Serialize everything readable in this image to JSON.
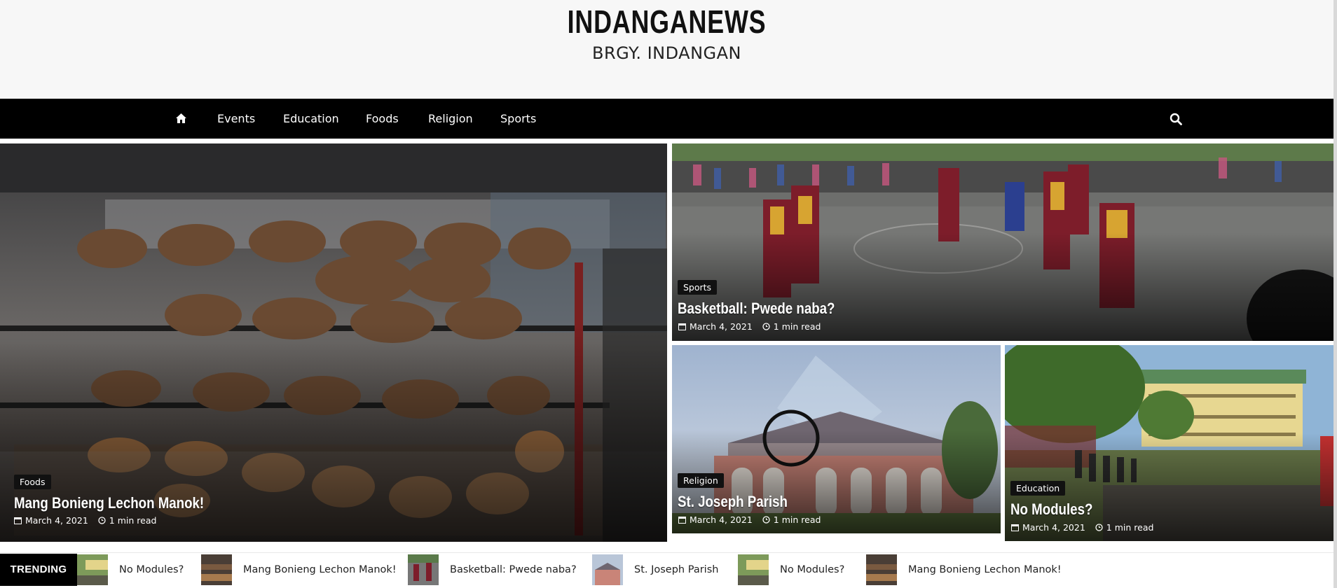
{
  "header": {
    "site_title": "INDANGANEWS",
    "tagline": "BRGY. INDANGAN"
  },
  "nav": {
    "home_icon": "home-icon",
    "items": [
      "Events",
      "Education",
      "Foods",
      "Religion",
      "Sports"
    ],
    "search_icon": "search-icon"
  },
  "posts": [
    {
      "category": "Foods",
      "title": "Mang Bonieng Lechon Manok!",
      "date": "March 4, 2021",
      "read_time": "1 min read"
    },
    {
      "category": "Sports",
      "title": "Basketball: Pwede naba?",
      "date": "March 4, 2021",
      "read_time": "1 min read"
    },
    {
      "category": "Religion",
      "title": "St. Joseph Parish",
      "date": "March 4, 2021",
      "read_time": "1 min read"
    },
    {
      "category": "Education",
      "title": "No Modules?",
      "date": "March 4, 2021",
      "read_time": "1 min read"
    }
  ],
  "trending": {
    "label": "TRENDING NEWS",
    "items": [
      "No Modules?",
      "Mang Bonieng Lechon Manok!",
      "Basketball: Pwede naba?",
      "St. Joseph Parish",
      "No Modules?",
      "Mang Bonieng Lechon Manok!"
    ]
  },
  "colors": {
    "nav_bg": "#000000",
    "header_bg": "#f7f7f7",
    "badge_bg": "#111111"
  }
}
